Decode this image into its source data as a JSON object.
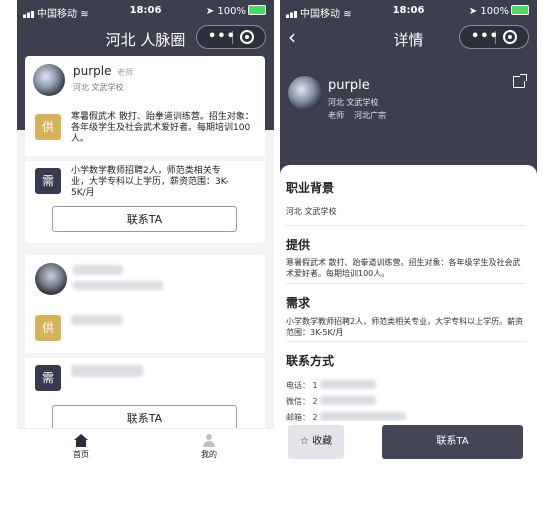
{
  "status": {
    "carrier": "中国移动",
    "time": "18:06",
    "battery": "100%"
  },
  "left": {
    "nav_title": "河北        人脉圈",
    "card1": {
      "name": "purple",
      "role": "老师",
      "org": "河北      文武学校",
      "supply_badge": "供",
      "supply_text": "寒暑假武术 散打、跆拳道训练营。招生对象：各年级学生及社会武术爱好者。每期培训100人。",
      "demand_badge": "需",
      "demand_text": "小学数学教师招聘2人，师范类相关专业，大学专科以上学历，薪资范围：3K-5K/月",
      "contact_button": "联系TA"
    },
    "card2": {
      "supply_badge": "供",
      "demand_badge": "需",
      "contact_button": "联系TA"
    },
    "tabs": [
      {
        "label": "首页",
        "icon": "home-icon"
      },
      {
        "label": "我的",
        "icon": "user-icon"
      }
    ]
  },
  "right": {
    "nav_title": "详情",
    "name": "purple",
    "org": "河北      文武学校",
    "role_region": "老师    河北广宗",
    "sections": {
      "background_title": "职业背景",
      "background_text": "河北      文武学校",
      "supply_title": "提供",
      "supply_text": "寒暑假武术 散打、跆拳道训练营。招生对象：各年级学生及社会武术爱好者。每期培训100人。",
      "demand_title": "需求",
      "demand_text": "小学数学教师招聘2人，师范类相关专业，大学专科以上学历。薪资范围：3K-5K/月",
      "contact_title": "联系方式",
      "phone_label": "电话：",
      "phone_prefix": "1",
      "wechat_label": "微信：",
      "wechat_prefix": "2",
      "email_label": "邮箱：",
      "email_prefix": "2"
    },
    "favorite_button": "收藏",
    "contact_button": "联系TA"
  },
  "colors": {
    "dark": "#3d3f4f",
    "gold": "#d6b35a",
    "navy": "#383a4f"
  }
}
